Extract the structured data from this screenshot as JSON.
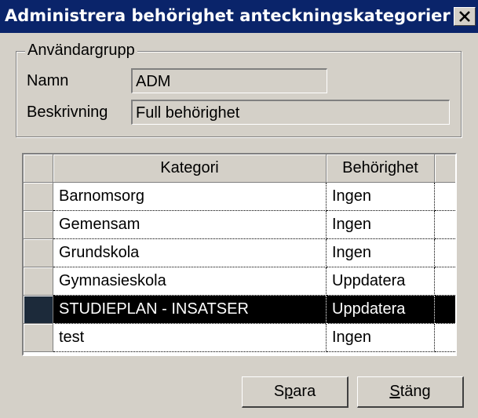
{
  "window": {
    "title": "Administrera behörighet anteckningskategorier",
    "close_glyph": "✕"
  },
  "group": {
    "legend": "Användargrupp",
    "name_label": "Namn",
    "name_value": "ADM",
    "desc_label": "Beskrivning",
    "desc_value": "Full behörighet"
  },
  "grid": {
    "columns": [
      "Kategori",
      "Behörighet"
    ],
    "rows": [
      {
        "kategori": "Barnomsorg",
        "behorighet": "Ingen",
        "selected": false
      },
      {
        "kategori": "Gemensam",
        "behorighet": "Ingen",
        "selected": false
      },
      {
        "kategori": "Grundskola",
        "behorighet": "Ingen",
        "selected": false
      },
      {
        "kategori": "Gymnasieskola",
        "behorighet": "Uppdatera",
        "selected": false
      },
      {
        "kategori": "STUDIEPLAN - INSATSER",
        "behorighet": "Uppdatera",
        "selected": true
      },
      {
        "kategori": "test",
        "behorighet": "Ingen",
        "selected": false
      }
    ]
  },
  "buttons": {
    "save_pre": "S",
    "save_accel": "p",
    "save_post": "ara",
    "close_pre": "",
    "close_accel": "S",
    "close_post": "täng"
  },
  "colors": {
    "titlebar": "#0a246a",
    "face": "#d4d0c8",
    "selection": "#000000"
  }
}
